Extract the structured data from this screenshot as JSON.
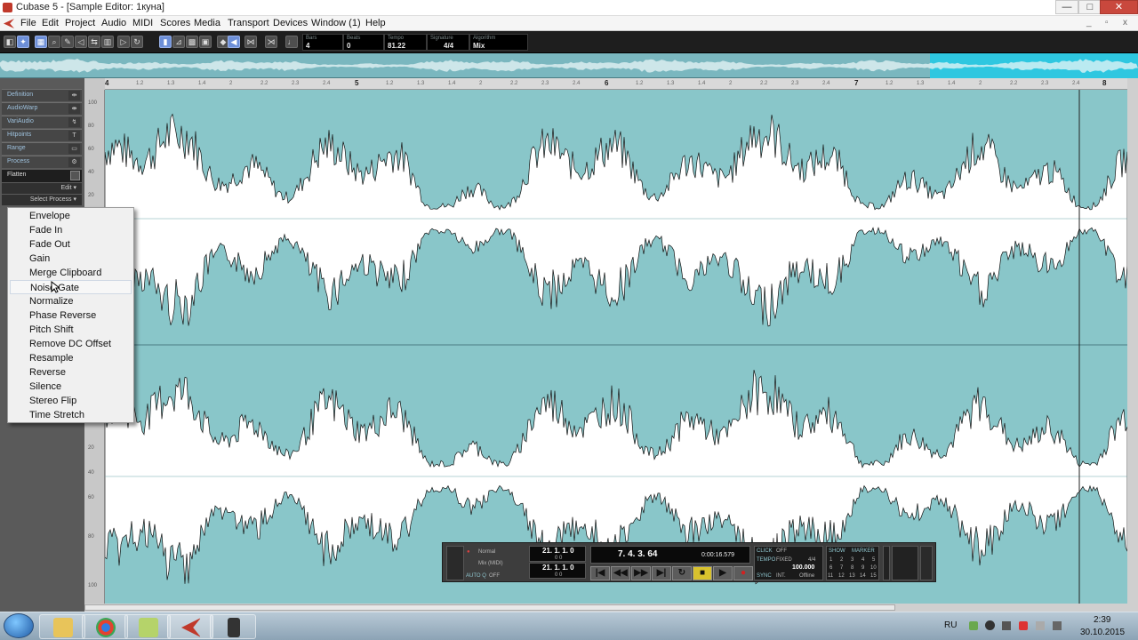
{
  "window": {
    "title": "Cubase 5 - [Sample Editor: 1куна]",
    "min": "—",
    "max": "□",
    "close": "✕"
  },
  "mdi": {
    "min": "_",
    "restore": "▫",
    "close": "x"
  },
  "menu": [
    "File",
    "Edit",
    "Project",
    "Audio",
    "MIDI",
    "Scores",
    "Media",
    "Transport",
    "Devices",
    "Window (1)",
    "Help"
  ],
  "toolbar": {
    "fields": [
      {
        "label": "Bars",
        "value": "4"
      },
      {
        "label": "Beats",
        "value": "0"
      },
      {
        "label": "Tempo",
        "value": "81.22"
      },
      {
        "label": "Signature",
        "value": "4/4"
      },
      {
        "label": "Algorithm",
        "value": "Mix"
      }
    ]
  },
  "ruler": {
    "bars": [
      "4",
      "5",
      "6",
      "7",
      "8"
    ],
    "sub": [
      "1.2",
      "1.3",
      "1.4",
      "2",
      "2.2",
      "2.3",
      "2.4",
      "3",
      "3.2",
      "3.3",
      "3.4",
      "4",
      "4.2",
      "4.3",
      "4.4"
    ]
  },
  "levels": [
    "100",
    "80",
    "60",
    "40",
    "20",
    "0",
    "20",
    "40",
    "60",
    "80",
    "100"
  ],
  "inspector": {
    "sections": [
      "Definition",
      "AudioWarp",
      "VariAudio",
      "Hitpoints",
      "Range",
      "Process"
    ],
    "icons": [
      "⇹",
      "⇼",
      "↯",
      "T",
      "▭",
      "⚙"
    ],
    "flatten": "Flatten",
    "edit": "Edit ▾",
    "select_process": "Select Process ▾"
  },
  "process_menu": {
    "items": [
      "Envelope",
      "Fade In",
      "Fade Out",
      "Gain",
      "Merge Clipboard",
      "Noise Gate",
      "Normalize",
      "Phase Reverse",
      "Pitch Shift",
      "Remove DC Offset",
      "Resample",
      "Reverse",
      "Silence",
      "Stereo Flip",
      "Time Stretch"
    ],
    "hovered": "Noise Gate"
  },
  "transport": {
    "mode": "Normal",
    "mix": "Mix (MIDI)",
    "auto_q": "AUTO Q",
    "auto_q_val": "OFF",
    "left_locator": "21. 1. 1.   0",
    "left_small": "0    0",
    "right_locator": "21. 1. 1.   0",
    "right_small": "0    0",
    "position_bars": "7. 4. 3. 64",
    "position_time": "0:00:16.579",
    "click": "CLICK",
    "click_val": "OFF",
    "tempo": "TEMPO",
    "tempo_mode": "FIXED",
    "signature": "4/4",
    "tempo_val": "100.000",
    "sync": "SYNC",
    "sync_mode": "INT.",
    "sync_state": "Offline",
    "show": "SHOW",
    "marker": "MARKER",
    "markers": [
      "1",
      "2",
      "3",
      "4",
      "5",
      "6",
      "7",
      "8",
      "9",
      "10",
      "11",
      "12",
      "13",
      "14",
      "15"
    ],
    "buttons": [
      "|◀",
      "◀◀",
      "▶▶",
      "▶|",
      "↻",
      "■",
      "▶",
      "●"
    ]
  },
  "taskbar": {
    "lang": "RU",
    "time": "2:39",
    "date": "30.10.2015"
  }
}
